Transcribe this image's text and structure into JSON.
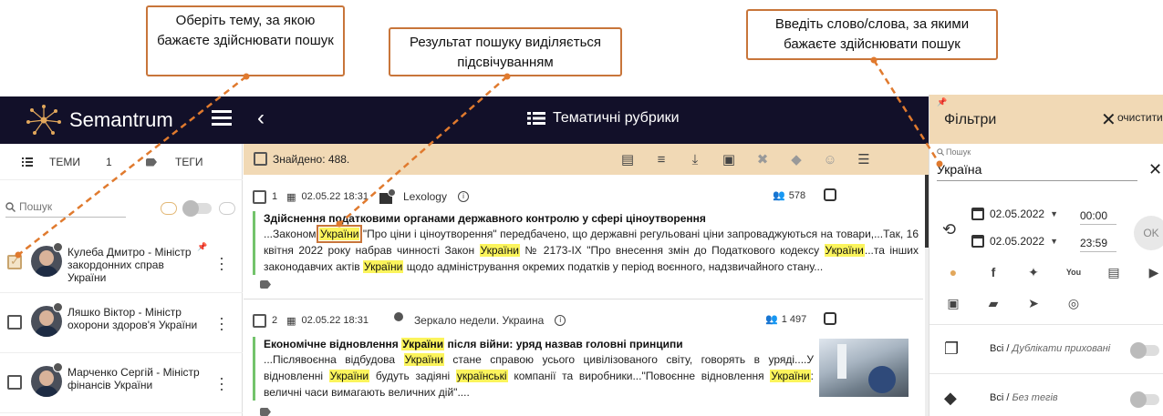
{
  "callouts": {
    "topic": "Оберіть тему, за якою бажаєте здійснювати пошук",
    "highlight": "Результат пошуку виділяється підсвічуванням",
    "search_words": "Введіть слово/слова, за якими бажаєте здійснювати пошук"
  },
  "app": {
    "logo_text": "Semantrum",
    "page_title": "Тематичні рубрики"
  },
  "left_panel": {
    "tab_topics": "ТЕМИ",
    "topics_count": "1",
    "tab_tags": "ТЕГИ",
    "search_placeholder": "Пошук",
    "items": [
      {
        "name": "Кулеба Дмитро - Міністр закордонних справ України",
        "checked": true
      },
      {
        "name": "Ляшко Віктор - Міністр охорони здоров'я України",
        "checked": false
      },
      {
        "name": "Марченко Сергій - Міністр фінансів України",
        "checked": false
      }
    ]
  },
  "results": {
    "found": "Знайдено: 488.",
    "articles": [
      {
        "num": "1",
        "datetime": "02.05.22 18:31",
        "source": "Lexology",
        "reach": "578",
        "title": "Здійснення податковими органами державного контролю у сфері ціноутворення",
        "text_parts": [
          "...Законом ",
          "України",
          " \"Про ціни і ціноутворення\" передбачено, що державні регульовані ціни запроваджуються на товари,...Так, 16 квітня 2022 року набрав чинності Закон ",
          "України",
          " № 2173-IX \"Про внесення змін до Податкового кодексу ",
          "України",
          "...та інших законодавчих актів ",
          "України",
          " щодо адміністрування окремих податків у період воєнного, надзвичайного стану..."
        ]
      },
      {
        "num": "2",
        "datetime": "02.05.22 18:31",
        "source": "Зеркало недели. Украина",
        "reach": "1 497",
        "title_parts": [
          "Економічне відновлення ",
          "України",
          " після війни: уряд назвав головні принципи"
        ],
        "text_parts": [
          "...Післявоєнна відбудова ",
          "України",
          " стане справою усього цивілізованого світу, говорять в уряді....У відновленні ",
          "України",
          " будуть задіяні ",
          "українські",
          " компанії та виробники...\"Повоєнне відновлення ",
          "України",
          ": величні часи вимагають величних дій\"...."
        ]
      }
    ]
  },
  "filters": {
    "title": "Фільтри",
    "clear": "очистити",
    "search_label": "Пошук",
    "search_value": "Україна",
    "date_from": "02.05.2022",
    "time_from": "00:00",
    "date_to": "02.05.2022",
    "time_to": "23:59",
    "ok": "OK",
    "duplicates_all": "Всі",
    "duplicates_label": "Дублікати приховані",
    "tags_all": "Всі",
    "tags_label": "Без тегів"
  },
  "colors": {
    "topbar": "#121029",
    "accent": "#f1d9b5",
    "callout_border": "#c8753a",
    "highlight": "#fbf45c",
    "article_bar": "#73c36b"
  }
}
